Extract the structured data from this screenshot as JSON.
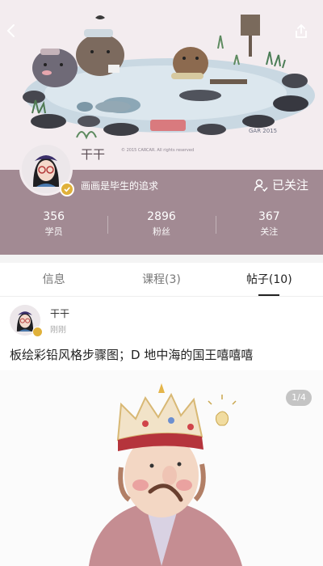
{
  "header": {
    "back_icon": "chevron-left-icon",
    "share_icon": "share-icon",
    "banner_credit": "© 2015 CARCAR. All rights reserved",
    "banner_signature": "GAR 2015"
  },
  "profile": {
    "username": "干干",
    "bio": "画画是毕生的追求",
    "follow_label": "已关注",
    "verified_color": "#e0b13a",
    "strip_color": "#a28a93"
  },
  "stats": [
    {
      "value": "356",
      "label": "学员"
    },
    {
      "value": "2896",
      "label": "粉丝"
    },
    {
      "value": "367",
      "label": "关注"
    }
  ],
  "tabs": [
    {
      "label": "信息",
      "active": false
    },
    {
      "label": "课程(3)",
      "active": false
    },
    {
      "label": "帖子(10)",
      "active": true
    }
  ],
  "post": {
    "author": "干干",
    "time": "刚刚",
    "text": "板绘彩铅风格步骤图；D 地中海的国王嘻嘻嘻",
    "page_indicator": "1/4"
  }
}
